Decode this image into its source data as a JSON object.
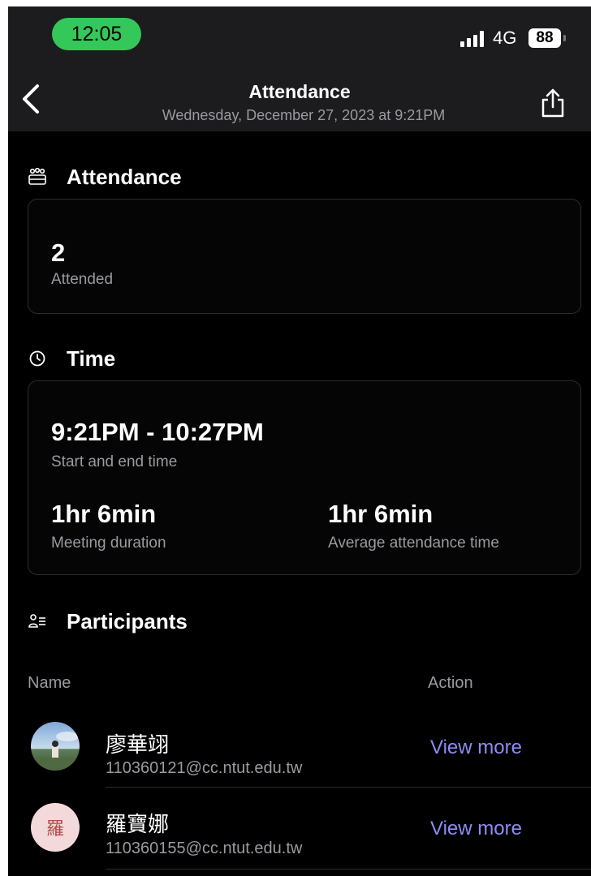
{
  "status_bar": {
    "time": "12:05",
    "network": "4G",
    "battery": "88"
  },
  "nav": {
    "title": "Attendance",
    "subtitle": "Wednesday, December 27, 2023 at 9:21PM"
  },
  "attendance_section": {
    "title": "Attendance",
    "count": "2",
    "count_label": "Attended"
  },
  "time_section": {
    "title": "Time",
    "range": "9:21PM - 10:27PM",
    "range_label": "Start and end time",
    "duration": "1hr 6min",
    "duration_label": "Meeting duration",
    "avg_time": "1hr 6min",
    "avg_time_label": "Average attendance time"
  },
  "participants_section": {
    "title": "Participants",
    "col_name": "Name",
    "col_action": "Action",
    "rows": [
      {
        "name": "廖華翊",
        "email": "110360121@cc.ntut.edu.tw",
        "action": "View more",
        "avatar_type": "photo"
      },
      {
        "name": "羅寶娜",
        "email": "110360155@cc.ntut.edu.tw",
        "action": "View more",
        "avatar_initial": "羅",
        "avatar_bg": "#f3d9d9",
        "avatar_fg": "#b04a4a"
      }
    ]
  },
  "colors": {
    "accent": "#8e8cf2",
    "status_pill": "#34c759",
    "background": "#000000",
    "muted_text": "#9a9a9f"
  }
}
